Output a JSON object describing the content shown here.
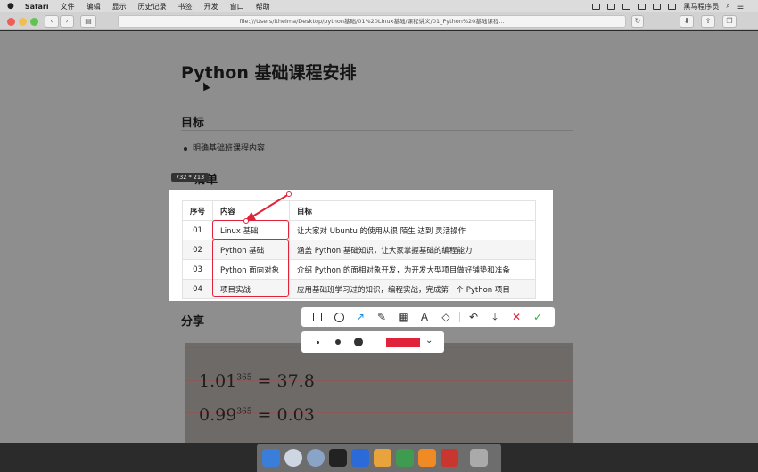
{
  "menubar": {
    "app": "Safari",
    "items": [
      "文件",
      "编辑",
      "显示",
      "历史记录",
      "书签",
      "开发",
      "窗口",
      "帮助"
    ],
    "user": "黑马程序员"
  },
  "browser": {
    "url": "file:///Users/itheima/Desktop/python基础/01%20Linux基础/课程讲义/01_Python%20基础课程..."
  },
  "doc": {
    "title": "Python 基础课程安排",
    "goal_heading": "目标",
    "goal_item": "明确基础班课程内容",
    "list_heading_partial": "清单",
    "share_heading": "分享"
  },
  "capture": {
    "size_label": "732 * 213",
    "headers": [
      "序号",
      "内容",
      "目标"
    ],
    "rows": [
      {
        "num": "01",
        "content": "Linux 基础",
        "goal": "让大家对 Ubuntu 的使用从很 陌生 达到 灵活操作"
      },
      {
        "num": "02",
        "content": "Python 基础",
        "goal": "涵盖 Python 基础知识，让大家掌握基础的编程能力"
      },
      {
        "num": "03",
        "content": "Python 面向对象",
        "goal": "介绍 Python 的面相对象开发，为开发大型项目做好铺垫和准备"
      },
      {
        "num": "04",
        "content": "项目实战",
        "goal": "应用基础班学习过的知识，编程实战，完成第一个 Python 项目"
      }
    ]
  },
  "annotation": {
    "accent_color": "#e0223a",
    "active_tool": "arrow"
  },
  "photo_equations": [
    {
      "base": "1.01",
      "exp": "365",
      "result": "= 37.8"
    },
    {
      "base": "0.99",
      "exp": "365",
      "result": "= 0.03"
    }
  ]
}
